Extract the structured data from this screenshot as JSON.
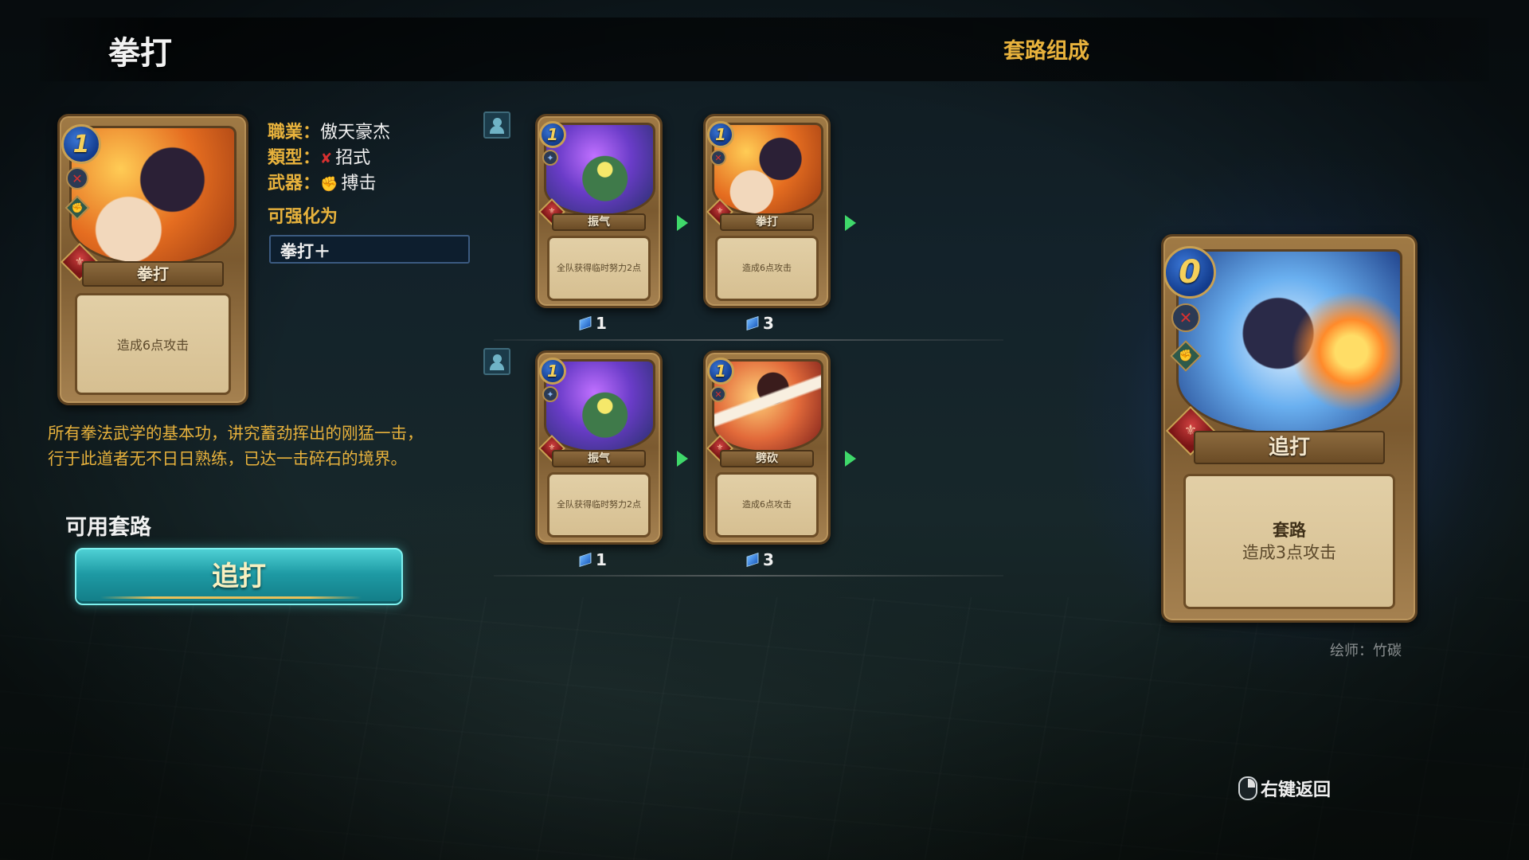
{
  "header": {
    "title": "拳打",
    "section_title": "套路组成"
  },
  "main_card": {
    "name": "拳打",
    "cost": "1",
    "text": "造成6点攻击",
    "art_icon": "fist-punch-art"
  },
  "info": {
    "profession_key": "職業：",
    "profession_value": "傲天豪杰",
    "type_key": "類型：",
    "type_value": "招式",
    "weapon_key": "武器：",
    "weapon_value": "搏击",
    "upgrade_label": "可强化为",
    "upgrade_value": "拳打＋"
  },
  "lore": "所有拳法武学的基本功，讲究蓄劲挥出的刚猛一击，行于此道者无不日日熟练，已达一击碎石的境界。",
  "available_combos": {
    "label": "可用套路",
    "button": "追打"
  },
  "sequences": [
    {
      "cards": [
        {
          "name": "振气",
          "cost": "1",
          "text": "全队获得临时努力2点",
          "count": "1",
          "art_icon": "qi-burst-art"
        },
        {
          "name": "拳打",
          "cost": "1",
          "text": "造成6点攻击",
          "count": "3",
          "art_icon": "fist-punch-art"
        }
      ]
    },
    {
      "cards": [
        {
          "name": "振气",
          "cost": "1",
          "text": "全队获得临时努力2点",
          "count": "1",
          "art_icon": "qi-burst-art"
        },
        {
          "name": "劈砍",
          "cost": "1",
          "text": "造成6点攻击",
          "count": "3",
          "art_icon": "sword-slash-art"
        }
      ]
    }
  ],
  "result_card": {
    "name": "追打",
    "cost": "0",
    "text_title": "套路",
    "text_body": "造成3点攻击",
    "art_icon": "flame-punch-art"
  },
  "artist": "绘师：竹碳",
  "back_hint": "右键返回",
  "colors": {
    "accent_gold": "#e8b23c",
    "button_teal": "#1e9aa4",
    "arrow_green": "#3fd86a"
  }
}
